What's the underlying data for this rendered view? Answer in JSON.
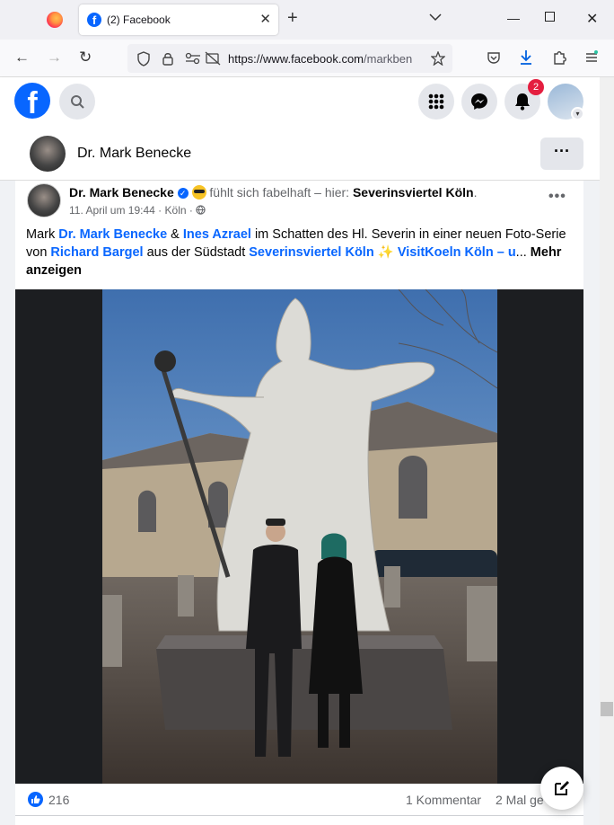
{
  "browser": {
    "tab_title": "(2) Facebook",
    "url_domain": "https://www.facebook.com",
    "url_path": "/markben"
  },
  "fb_header": {
    "logo_letter": "f",
    "notifications_badge": "2"
  },
  "profile_bar": {
    "name": "Dr. Mark Benecke",
    "more_label": "···"
  },
  "post": {
    "author": "Dr. Mark Benecke",
    "feeling_text": "fühlt sich fabelhaft – hier:",
    "location": "Severinsviertel Köln",
    "location_suffix": ".",
    "date": "11. April um 19:44",
    "city": "Köln",
    "text_parts": {
      "p1": "Mark ",
      "link1": "Dr. Mark Benecke",
      "p2": " & ",
      "link2": "Ines Azrael",
      "p3": " im Schatten des Hl. Severin in einer neuen Foto-Serie von ",
      "link3": "Richard Bargel",
      "p4": " aus der Südstadt ",
      "link4": "Severinsviertel Köln",
      "sparkle": " ✨ ",
      "link5": "VisitKoeln Köln – u",
      "ellipsis": "... ",
      "more": "Mehr anzeigen"
    },
    "likes": "216",
    "comments": "1 Kommentar",
    "shares": "2 Mal ge"
  },
  "icons": {
    "facebook_logo": "facebook-logo-icon",
    "search": "search-icon",
    "menu": "grid-menu-icon",
    "messenger": "messenger-icon",
    "bell": "bell-icon",
    "compose": "compose-icon"
  }
}
